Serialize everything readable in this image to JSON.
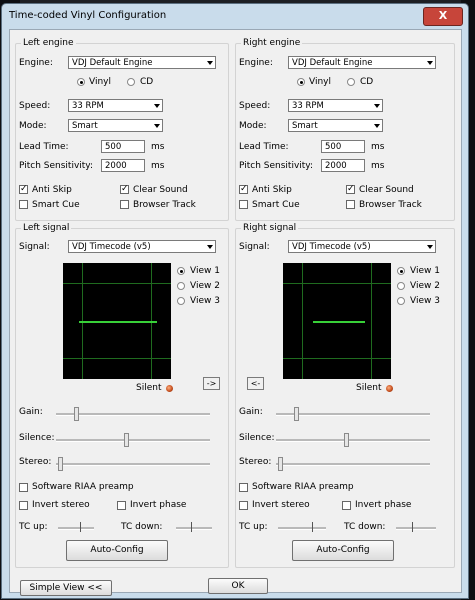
{
  "window": {
    "title": "Time-coded Vinyl Configuration",
    "close_glyph": "X"
  },
  "left_engine": {
    "group_label": "Left engine",
    "engine_label": "Engine:",
    "engine_value": "VDJ Default Engine",
    "vinyl_label": "Vinyl",
    "cd_label": "CD",
    "vinyl_selected": true,
    "speed_label": "Speed:",
    "speed_value": "33 RPM",
    "mode_label": "Mode:",
    "mode_value": "Smart",
    "lead_label": "Lead Time:",
    "lead_value": "500",
    "lead_unit": "ms",
    "pitch_label": "Pitch Sensitivity:",
    "pitch_value": "2000",
    "pitch_unit": "ms",
    "anti_skip_label": "Anti Skip",
    "anti_skip_checked": true,
    "clear_sound_label": "Clear Sound",
    "clear_sound_checked": true,
    "smart_cue_label": "Smart Cue",
    "smart_cue_checked": false,
    "browser_track_label": "Browser Track",
    "browser_track_checked": false
  },
  "right_engine": {
    "group_label": "Right engine",
    "engine_label": "Engine:",
    "engine_value": "VDJ Default Engine",
    "vinyl_label": "Vinyl",
    "cd_label": "CD",
    "vinyl_selected": true,
    "speed_label": "Speed:",
    "speed_value": "33 RPM",
    "mode_label": "Mode:",
    "mode_value": "Smart",
    "lead_label": "Lead Time:",
    "lead_value": "500",
    "lead_unit": "ms",
    "pitch_label": "Pitch Sensitivity:",
    "pitch_value": "2000",
    "pitch_unit": "ms",
    "anti_skip_label": "Anti Skip",
    "anti_skip_checked": true,
    "clear_sound_label": "Clear Sound",
    "clear_sound_checked": true,
    "smart_cue_label": "Smart Cue",
    "smart_cue_checked": false,
    "browser_track_label": "Browser Track",
    "browser_track_checked": false
  },
  "left_signal": {
    "group_label": "Left signal",
    "signal_label": "Signal:",
    "signal_value": "VDJ Timecode (v5)",
    "view1": "View 1",
    "view2": "View 2",
    "view3": "View 3",
    "selected_view": 1,
    "silent_label": "Silent",
    "copy_button": "->",
    "gain_label": "Gain:",
    "gain_level": 0.13,
    "silence_label": "Silence:",
    "silence_level": 0.44,
    "stereo_label": "Stereo:",
    "stereo_level": 0.02,
    "riaa_label": "Software RIAA preamp",
    "riaa_checked": false,
    "invert_stereo_label": "Invert stereo",
    "invert_stereo_checked": false,
    "invert_phase_label": "Invert phase",
    "invert_phase_checked": false,
    "tc_up_label": "TC up:",
    "tc_down_label": "TC down:",
    "auto_config_label": "Auto-Config"
  },
  "right_signal": {
    "group_label": "Right signal",
    "signal_label": "Signal:",
    "signal_value": "VDJ Timecode (v5)",
    "view1": "View 1",
    "view2": "View 2",
    "view3": "View 3",
    "selected_view": 1,
    "silent_label": "Silent",
    "copy_button": "<-",
    "gain_label": "Gain:",
    "gain_level": 0.13,
    "silence_label": "Silence:",
    "silence_level": 0.44,
    "stereo_label": "Stereo:",
    "stereo_level": 0.02,
    "riaa_label": "Software RIAA preamp",
    "riaa_checked": false,
    "invert_stereo_label": "Invert stereo",
    "invert_stereo_checked": false,
    "invert_phase_label": "Invert phase",
    "invert_phase_checked": false,
    "tc_up_label": "TC up:",
    "tc_down_label": "TC down:",
    "auto_config_label": "Auto-Config"
  },
  "footer": {
    "simple_view_label": "Simple View <<",
    "ok_label": "OK"
  },
  "colors": {
    "titlebar": "#c9dceb",
    "dialog_bg": "#f0f0f0",
    "scope_bg": "#000000",
    "scope_trace": "#38d038",
    "led": "#c24a1a"
  }
}
